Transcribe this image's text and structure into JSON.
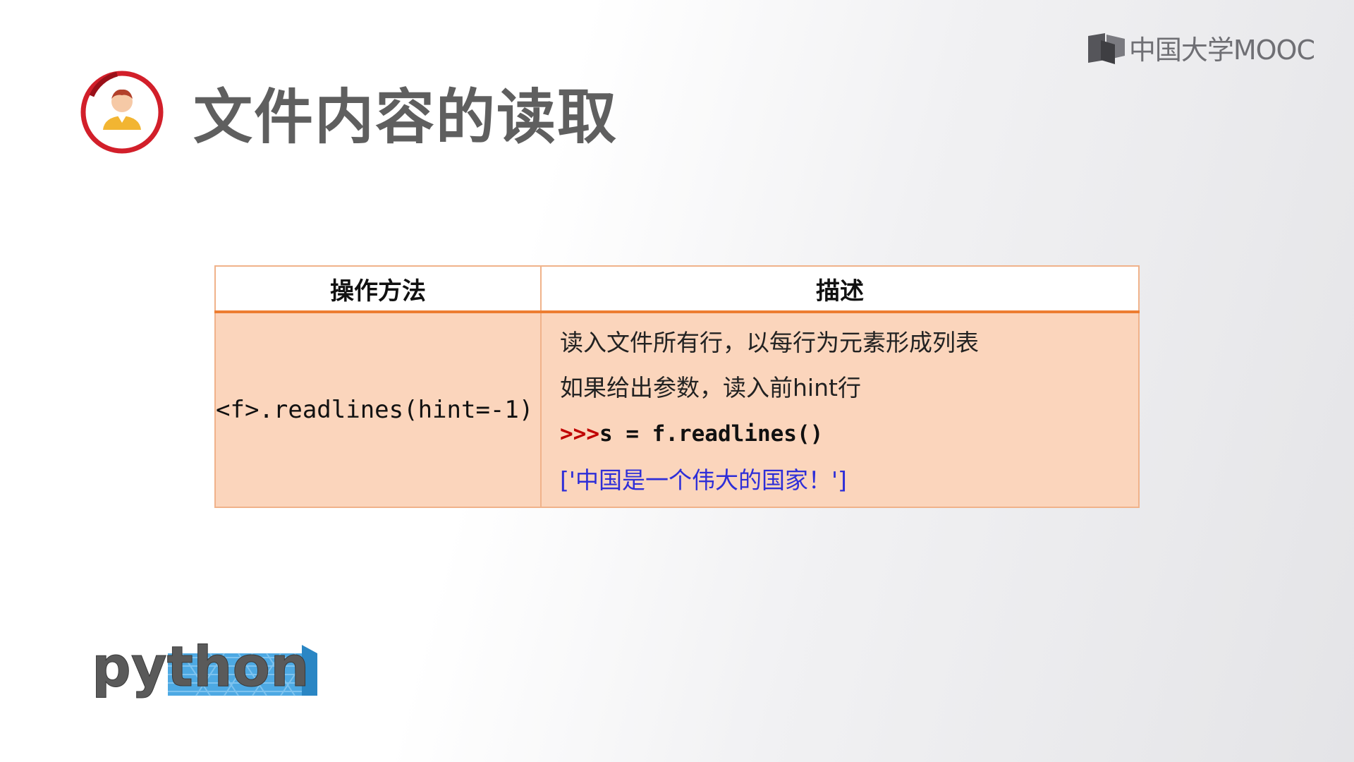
{
  "brand": {
    "name": "中国大学MOOC",
    "icon": "book-logo-icon"
  },
  "slide": {
    "title": "文件内容的读取",
    "title_icon": "person-avatar-icon"
  },
  "table": {
    "headers": {
      "method": "操作方法",
      "description": "描述"
    },
    "row": {
      "method": "<f>.readlines(hint=-1)",
      "desc_line1": "读入文件所有行，以每行为元素形成列表",
      "desc_line2": "如果给出参数，读入前hint行",
      "code_prompt": ">>>",
      "code_stmt": "s = f.readlines()",
      "output": "['中国是一个伟大的国家！']"
    }
  },
  "footer_logo": {
    "text": "python"
  },
  "colors": {
    "accent_orange": "#ed7d31",
    "cell_fill": "#fbd5bc",
    "avatar_ring": "#d21f2a",
    "prompt_red": "#c00000",
    "output_blue": "#2e2ed8",
    "python_blue": "#3aa0e0"
  }
}
